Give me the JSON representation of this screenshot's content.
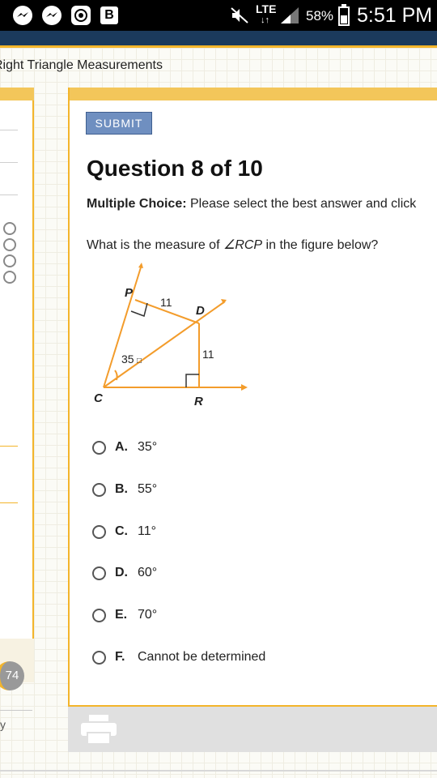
{
  "status_bar": {
    "lte": "LTE",
    "lte_arrows": "↓↑",
    "battery_pct": "58%",
    "battery_level": 0.58,
    "time": "5:51 PM",
    "icons": [
      "messenger-icon",
      "messenger-icon",
      "shield-icon",
      "b-app-icon",
      "mute-icon",
      "signal-icon",
      "battery-icon"
    ]
  },
  "page": {
    "title": "Right Triangle Measurements"
  },
  "left_panel": {
    "progress_value": "74",
    "footer_text": "y"
  },
  "question": {
    "submit_label": "SUBMIT",
    "title": "Question 8 of 10",
    "instruction_bold": "Multiple Choice:",
    "instruction_rest": " Please select the best answer and click",
    "text_before": "What is the measure of ",
    "angle_symbol": "∠",
    "angle_name": "RCP",
    "text_after": " in the figure below?"
  },
  "figure": {
    "label_P": "P",
    "label_D": "D",
    "label_C": "C",
    "label_R": "R",
    "label_PD": "11",
    "label_DR": "11",
    "label_angle": "35",
    "degree_symbol": "□"
  },
  "choices": [
    {
      "letter": "A.",
      "text": "35°"
    },
    {
      "letter": "B.",
      "text": "55°"
    },
    {
      "letter": "C.",
      "text": "11°"
    },
    {
      "letter": "D.",
      "text": "60°"
    },
    {
      "letter": "E.",
      "text": "70°"
    },
    {
      "letter": "F.",
      "text": "Cannot be determined"
    }
  ],
  "colors": {
    "accent_orange": "#f3b52b",
    "navy": "#1b3a5c",
    "submit_blue": "#6f8fc0",
    "figure_orange": "#f39c2b"
  }
}
